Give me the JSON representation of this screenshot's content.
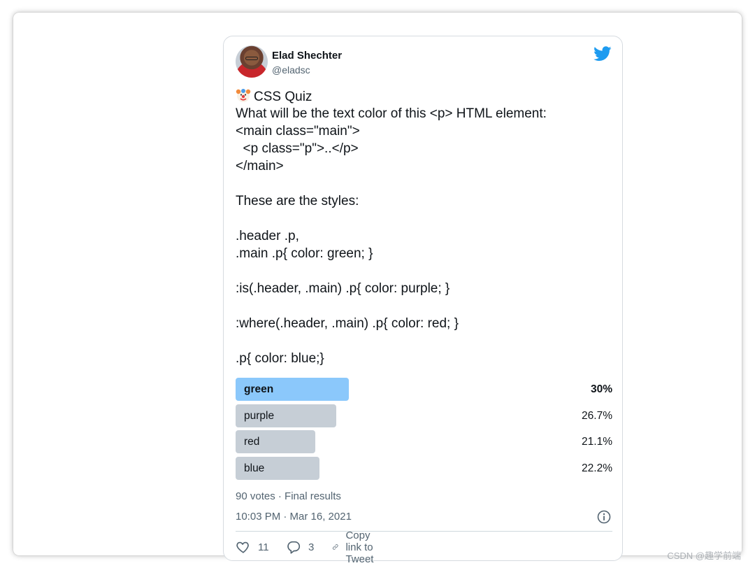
{
  "tweet": {
    "author_name": "Elad Shechter",
    "author_handle": "@eladsc",
    "lines": [
      "CSS Quiz",
      "What will be the text color of this <p> HTML element:",
      "<main class=\"main\">",
      "  <p class=\"p\">..</p>",
      "</main>",
      "",
      "These are the styles:",
      "",
      ".header .p,",
      ".main .p{ color: green; }",
      "",
      ":is(.header, .main) .p{ color: purple; }",
      "",
      ":where(.header, .main) .p{ color: red; }",
      "",
      ".p{ color: blue;}"
    ],
    "poll": {
      "options": [
        {
          "label": "green",
          "percent_text": "30%",
          "percent": 30.0,
          "winner": true
        },
        {
          "label": "purple",
          "percent_text": "26.7%",
          "percent": 26.7,
          "winner": false
        },
        {
          "label": "red",
          "percent_text": "21.1%",
          "percent": 21.1,
          "winner": false
        },
        {
          "label": "blue",
          "percent_text": "22.2%",
          "percent": 22.2,
          "winner": false
        }
      ],
      "summary": "90 votes · Final results"
    },
    "timestamp": "10:03 PM · Mar 16, 2021",
    "actions": {
      "likes": "11",
      "replies": "3",
      "copy_link": "Copy link to Tweet"
    }
  },
  "watermark": "CSDN @趣学前端",
  "colors": {
    "twitter_blue": "#1d9bf0",
    "winner_bar": "#8bc8fb",
    "other_bar": "#c6ced6"
  },
  "icons": [
    "clown-face-emoji",
    "twitter-bird-icon",
    "info-icon",
    "heart-icon",
    "reply-icon",
    "link-icon"
  ]
}
